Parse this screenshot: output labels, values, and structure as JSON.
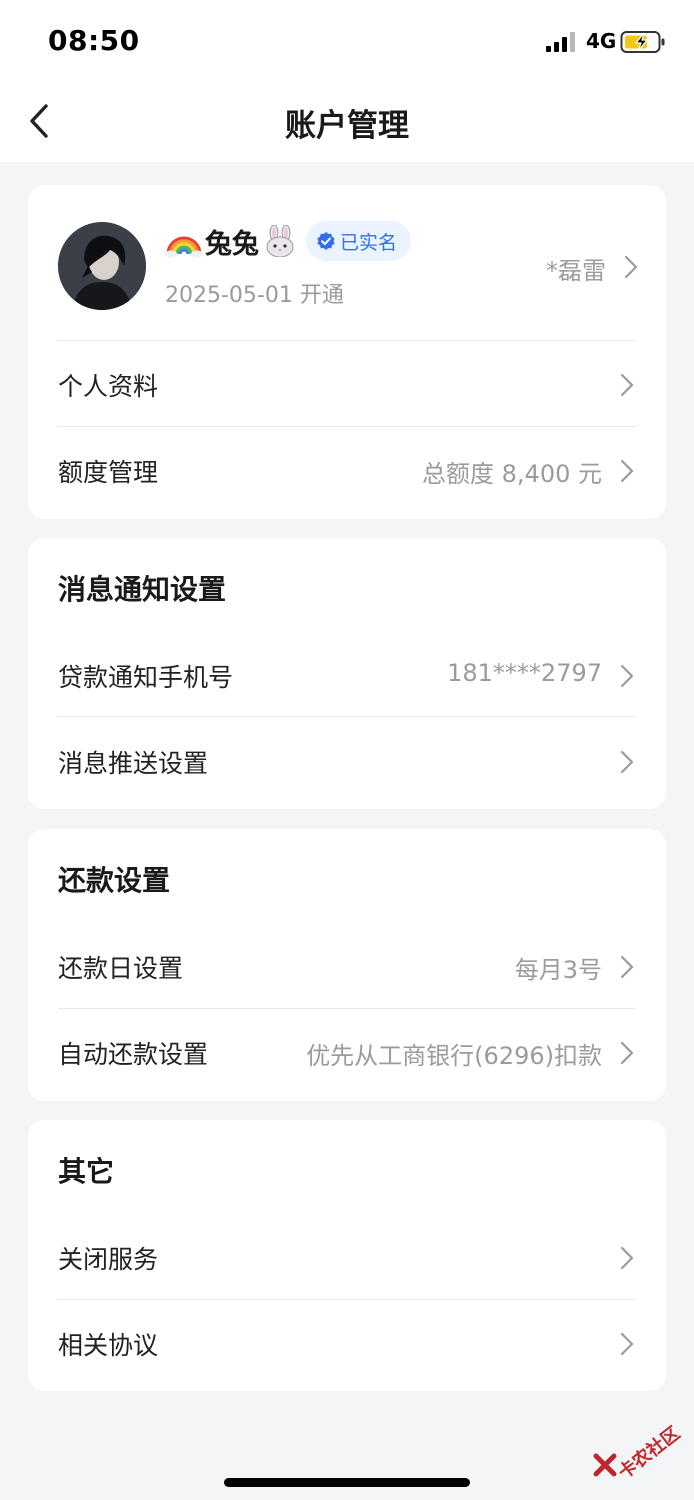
{
  "status_bar": {
    "time": "08:50",
    "network": "4G",
    "icons": [
      "signal-icon",
      "battery-charging-icon"
    ]
  },
  "nav": {
    "title": "账户管理",
    "back_icon": "chevron-left-icon"
  },
  "profile": {
    "name": "兔兔",
    "name_icons": [
      "rainbow-icon",
      "rabbit-face-icon"
    ],
    "verified_label": "已实名",
    "open_date": "2025-05-01 开通",
    "masked_name": "*磊雷"
  },
  "account_rows": [
    {
      "label": "个人资料",
      "value": ""
    },
    {
      "label": "额度管理",
      "value": "总额度 8,400 元"
    }
  ],
  "notify_section": {
    "title": "消息通知设置",
    "rows": [
      {
        "label": "贷款通知手机号",
        "value": "181****2797"
      },
      {
        "label": "消息推送设置",
        "value": ""
      }
    ]
  },
  "repay_section": {
    "title": "还款设置",
    "rows": [
      {
        "label": "还款日设置",
        "value": "每月3号"
      },
      {
        "label": "自动还款设置",
        "value": "优先从工商银行(6296)扣款"
      }
    ]
  },
  "other_section": {
    "title": "其它",
    "rows": [
      {
        "label": "关闭服务",
        "value": ""
      },
      {
        "label": "相关协议",
        "value": ""
      }
    ]
  },
  "watermark": {
    "text": "卡农社区"
  },
  "colors": {
    "background": "#f4f5f7",
    "card": "#ffffff",
    "accent_blue": "#2f6ff0",
    "badge_bg": "#eaf3ff",
    "secondary_text": "#9b9b9b",
    "watermark_red": "#c0272d"
  }
}
